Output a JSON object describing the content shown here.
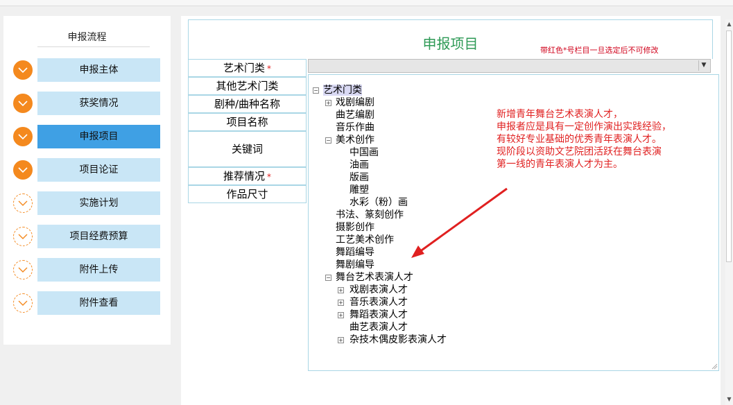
{
  "sidebar": {
    "title": "申报流程",
    "steps": [
      {
        "label": "申报主体",
        "status": "done"
      },
      {
        "label": "获奖情况",
        "status": "done"
      },
      {
        "label": "申报项目",
        "status": "active"
      },
      {
        "label": "项目论证",
        "status": "done"
      },
      {
        "label": "实施计划",
        "status": "todo"
      },
      {
        "label": "项目经费预算",
        "status": "todo"
      },
      {
        "label": "附件上传",
        "status": "todo"
      },
      {
        "label": "附件查看",
        "status": "todo"
      }
    ]
  },
  "form": {
    "title": "申报项目",
    "note": "带红色*号栏目一旦选定后不可修改",
    "required_mark": "*",
    "fields": [
      {
        "label": "艺术门类",
        "required": true
      },
      {
        "label": "其他艺术门类",
        "required": false
      },
      {
        "label": "剧种/曲种名称",
        "required": false
      },
      {
        "label": "项目名称",
        "required": false
      },
      {
        "label": "关键词",
        "required": false
      },
      {
        "label": "推荐情况",
        "required": true
      },
      {
        "label": "作品尺寸",
        "required": false
      }
    ],
    "select_value": ""
  },
  "tree": {
    "nodes": [
      {
        "label": "艺术门类",
        "toggle": "minus",
        "selected": true
      },
      {
        "label": "戏剧编剧",
        "toggle": "plus"
      },
      {
        "label": "曲艺编剧",
        "toggle": "none"
      },
      {
        "label": "音乐作曲",
        "toggle": "none"
      },
      {
        "label": "美术创作",
        "toggle": "minus"
      },
      {
        "label": "中国画",
        "toggle": "none"
      },
      {
        "label": "油画",
        "toggle": "none"
      },
      {
        "label": "版画",
        "toggle": "none"
      },
      {
        "label": "雕塑",
        "toggle": "none"
      },
      {
        "label": "水彩（粉）画",
        "toggle": "none"
      },
      {
        "label": "书法、篆刻创作",
        "toggle": "none"
      },
      {
        "label": "摄影创作",
        "toggle": "none"
      },
      {
        "label": "工艺美术创作",
        "toggle": "none"
      },
      {
        "label": "舞蹈编导",
        "toggle": "none"
      },
      {
        "label": "舞剧编导",
        "toggle": "none"
      },
      {
        "label": "舞台艺术表演人才",
        "toggle": "minus"
      },
      {
        "label": "戏剧表演人才",
        "toggle": "plus"
      },
      {
        "label": "音乐表演人才",
        "toggle": "plus"
      },
      {
        "label": "舞蹈表演人才",
        "toggle": "plus"
      },
      {
        "label": "曲艺表演人才",
        "toggle": "none"
      },
      {
        "label": "杂技木偶皮影表演人才",
        "toggle": "plus"
      }
    ]
  },
  "annotation": {
    "lines": [
      "新增青年舞台艺术表演人才，",
      "申报者应是具有一定创作演出实践经验，",
      "有较好专业基础的优秀青年表演人才。",
      "现阶段以资助文艺院团活跃在舞台表演",
      "第一线的青年表演人才为主。"
    ],
    "color": "#e02020"
  },
  "colors": {
    "accent_orange": "#f4891e",
    "step_bg": "#c9e6f6",
    "step_active_bg": "#3fa0e4",
    "title_green": "#2e9a56",
    "border_blue": "#a9d6e5"
  }
}
